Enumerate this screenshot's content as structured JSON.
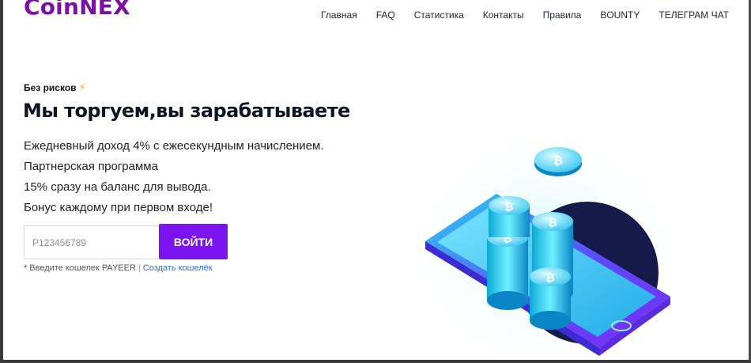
{
  "brand": {
    "logo": "CoinNEX",
    "color": "#7b0fa6"
  },
  "nav": {
    "items": [
      "Главная",
      "FAQ",
      "Статистика",
      "Контакты",
      "Правила",
      "BOUNTY",
      "ТЕЛЕГРАМ ЧАТ"
    ]
  },
  "hero": {
    "eyebrow": "Без рисков",
    "eyebrow_icon": "lightning-icon",
    "headline": "Мы торгуем,вы зарабатываете",
    "features": [
      "Ежедневный доход 4% с ежесекундным начислением.",
      "Партнерская программа",
      "15% сразу на баланс для вывода.",
      "Бонус каждому при первом входе!"
    ]
  },
  "login": {
    "placeholder": "P123456789",
    "button_label": "ВОЙТИ",
    "button_color": "#7b14f0",
    "hint_text": "Введите кошелек PAYEER",
    "hint_separator": "|",
    "create_link": "Создать кошелёк"
  },
  "illustration": {
    "name": "phone-with-bitcoin-coins",
    "coin_symbol": "₿"
  }
}
